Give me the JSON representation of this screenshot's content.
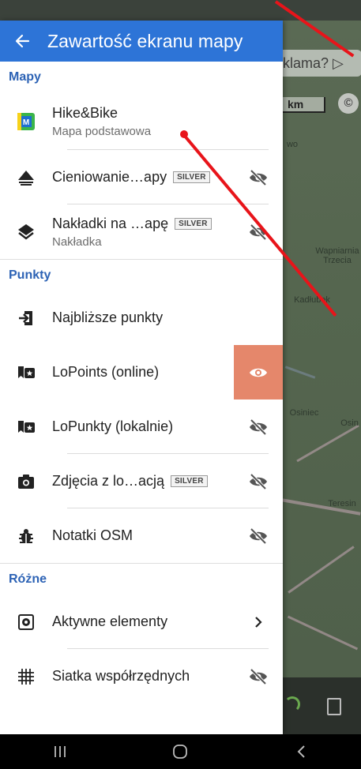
{
  "header": {
    "title": "Zawartość ekranu mapy"
  },
  "map": {
    "ad_text": "eklama? ▷",
    "scale_label": "km",
    "copyright": "©",
    "places": [
      "wo",
      "Wapniarnia Trzecia",
      "Kadłubek",
      "Osiniec",
      "Osin",
      "Teresin"
    ]
  },
  "sections": {
    "maps": {
      "title": "Mapy",
      "items": [
        {
          "title": "Hike&Bike",
          "subtitle": "Mapa podstawowa",
          "icon": "locus-map-icon"
        },
        {
          "title": "Cieniowanie…apy",
          "badge": "SILVER",
          "icon": "hill-shading-icon",
          "trailing": "eye-off-icon"
        },
        {
          "title": "Nakładki na …apę",
          "badge": "SILVER",
          "subtitle": "Nakładka",
          "icon": "layers-icon",
          "trailing": "eye-off-icon"
        }
      ]
    },
    "points": {
      "title": "Punkty",
      "items": [
        {
          "title": "Najbliższe punkty",
          "icon": "login-arrow-icon"
        },
        {
          "title": "LoPoints (online)",
          "icon": "lopoints-icon",
          "trailing": "eye-icon",
          "active": true
        },
        {
          "title": "LoPunkty (lokalnie)",
          "icon": "lopoints-icon",
          "trailing": "eye-off-icon"
        },
        {
          "title": "Zdjęcia z lo…acją",
          "badge": "SILVER",
          "icon": "camera-icon",
          "trailing": "eye-off-icon"
        },
        {
          "title": "Notatki OSM",
          "icon": "bug-icon",
          "trailing": "eye-off-icon"
        }
      ]
    },
    "other": {
      "title": "Różne",
      "items": [
        {
          "title": "Aktywne elementy",
          "icon": "active-elements-icon",
          "trailing": "chevron-right-icon"
        },
        {
          "title": "Siatka współrzędnych",
          "icon": "grid-icon",
          "trailing": "eye-off-icon"
        }
      ]
    }
  },
  "colors": {
    "header": "#2d74d7",
    "section": "#2d63b5",
    "active_eye_bg": "#e5876b",
    "annotation": "#e8141a"
  }
}
